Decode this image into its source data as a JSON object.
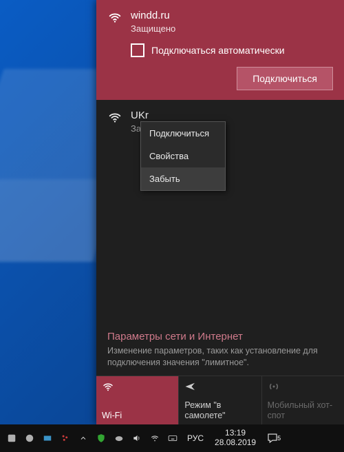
{
  "colors": {
    "accent": "#9b3346"
  },
  "flyout": {
    "selected": {
      "ssid": "windd.ru",
      "status": "Защищено",
      "auto_label": "Подключаться автоматически",
      "connect_label": "Подключиться"
    },
    "other": {
      "ssid_partial": "UKr",
      "status_partial": "Защ"
    },
    "context_menu": {
      "items": [
        "Подключиться",
        "Свойства",
        "Забыть"
      ],
      "hovered_index": 2
    },
    "settings": {
      "title": "Параметры сети и Интернет",
      "desc": "Изменение параметров, таких как установление для подключения значения \"лимитное\"."
    },
    "tiles": [
      {
        "icon": "wifi-icon",
        "label": "Wi-Fi",
        "state": "active"
      },
      {
        "icon": "airplane-icon",
        "label": "Режим \"в самолете\"",
        "state": "inactive"
      },
      {
        "icon": "hotspot-icon",
        "label": "Мобильный хот-спот",
        "state": "disabled"
      }
    ]
  },
  "taskbar": {
    "lang": "РУС",
    "time": "13:19",
    "date": "28.08.2019",
    "notif_count": "5"
  }
}
